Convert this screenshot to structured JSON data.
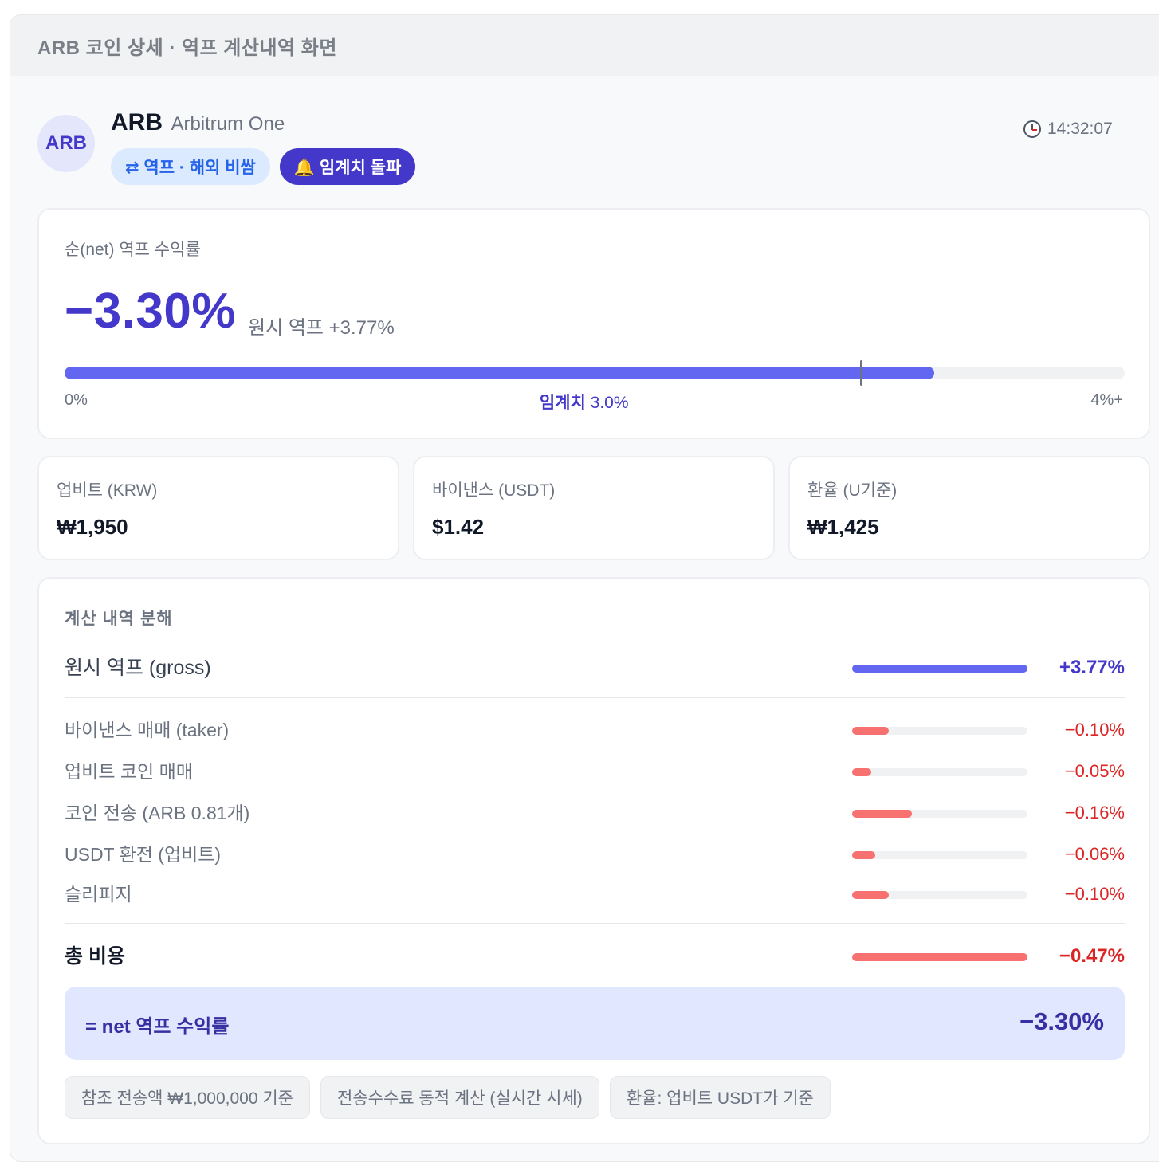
{
  "window": {
    "title": "ARB 코인 상세 · 역프 계산내역 화면"
  },
  "coin": {
    "avatar": "ARB",
    "symbol": "ARB",
    "name": "Arbitrum One",
    "badges": [
      {
        "icon": "swap-arrows-icon",
        "label": "⇄ 역프 · 해외 비쌈"
      },
      {
        "icon": "bell-icon",
        "label": "🔔 임계치 돌파"
      }
    ],
    "time": "14:32:07"
  },
  "net": {
    "label": "순(net) 역프 수익률",
    "value": "−3.30%",
    "gross_caption": "원시 역프 +3.77%",
    "progress_fraction": 0.82,
    "threshold_fraction": 0.75,
    "scale_min": "0%",
    "threshold_label": "임계치",
    "threshold_value": "3.0%",
    "scale_max": "4%+"
  },
  "prices": [
    {
      "label": "업비트 (KRW)",
      "value": "₩1,950"
    },
    {
      "label": "바이낸스 (USDT)",
      "value": "$1.42"
    },
    {
      "label": "환율 (U기준)",
      "value": "₩1,425"
    }
  ],
  "breakdown": {
    "title": "계산 내역 분해",
    "gross": {
      "label": "원시 역프 (gross)",
      "value": "+3.77%",
      "bar": 1.0
    },
    "costs": [
      {
        "label": "바이낸스 매매 (taker)",
        "value": "−0.10%",
        "bar": 0.21
      },
      {
        "label": "업비트 코인 매매",
        "value": "−0.05%",
        "bar": 0.11
      },
      {
        "label": "코인 전송 (ARB 0.81개)",
        "value": "−0.16%",
        "bar": 0.34
      },
      {
        "label": "USDT 환전 (업비트)",
        "value": "−0.06%",
        "bar": 0.13
      },
      {
        "label": "슬리피지",
        "value": "−0.10%",
        "bar": 0.21
      }
    ],
    "total": {
      "label": "총 비용",
      "value": "−0.47%",
      "bar": 1.0
    },
    "result": {
      "label": "= net 역프 수익률",
      "value": "−3.30%"
    },
    "notes": [
      "참조 전송액 ₩1,000,000 기준",
      "전송수수료 동적 계산 (실시간 시세)",
      "환율: 업비트 USDT가 기준"
    ]
  },
  "colors": {
    "accent": "#4338ca",
    "bar": "#6366f1",
    "cost": "#f87171",
    "negative": "#dc2626"
  }
}
